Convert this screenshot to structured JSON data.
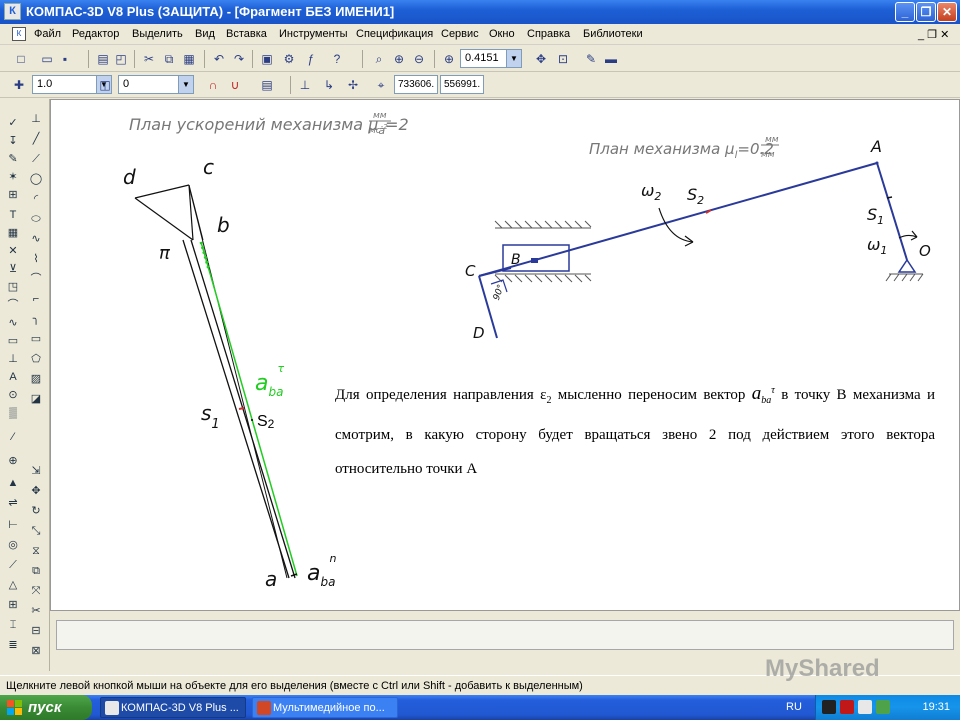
{
  "window": {
    "title": "КОМПАС-3D V8 Plus (ЗАЩИТА) - [Фрагмент БЕЗ ИМЕНИ1]",
    "app_icon": "К",
    "minimize_icon": "_",
    "maximize_icon": "❐",
    "close_icon": "✕"
  },
  "menu": {
    "items": [
      "Файл",
      "Редактор",
      "Выделить",
      "Вид",
      "Вставка",
      "Инструменты",
      "Спецификация",
      "Сервис",
      "Окно",
      "Справка",
      "Библиотеки"
    ],
    "doc_controls": "_ ❐ ✕"
  },
  "toolbar": {
    "zoom_value": "0.4151",
    "style_value": "1.0",
    "layer_value": "0",
    "coord_x": "733606.",
    "coord_y": "556991."
  },
  "drawing": {
    "accel_plan_label": "План ускорений механизма μ",
    "accel_plan_sub": "a",
    "accel_plan_eq": "=2",
    "accel_plan_unit_top": "мм",
    "accel_plan_unit_bottom": "мс",
    "accel_plan_unit_exp": "-2",
    "mech_plan_label": "План механизма μ",
    "mech_plan_sub": "l",
    "mech_plan_eq": "=0.2",
    "mech_plan_unit_top": "мм",
    "mech_plan_unit_bottom": "мм",
    "pt_d": "d",
    "pt_c": "c",
    "pt_b": "b",
    "pt_pi": "π",
    "pt_s1": "s",
    "pt_s1_sub": "1",
    "pt_s2": "S",
    "pt_s2_sub": "2",
    "pt_a": "a",
    "a_ba_tau": "a",
    "a_ba_tau_sub": "ba",
    "a_ba_tau_sup": "τ",
    "a_ba_n": "a",
    "a_ba_n_sub": "ba",
    "a_ba_n_sup": "n",
    "mech_A": "A",
    "mech_B": "B",
    "mech_C": "C",
    "mech_D": "D",
    "mech_O": "O",
    "mech_S1": "S",
    "mech_S1_sub": "1",
    "mech_S2": "S",
    "mech_S2_sub": "2",
    "mech_w1": "ω",
    "mech_w1_sub": "1",
    "mech_w2": "ω",
    "mech_w2_sub": "2",
    "mech_angle": "90°"
  },
  "note": {
    "part1": "Для определения направления ε",
    "eps_sub": "2",
    "part2": " мысленно переносим вектор ",
    "vec_a": "a",
    "vec_sub": "ba",
    "vec_sup": "τ",
    "part3": " в точку В механизма и смотрим, в какую сторону будет вращаться звено 2 под действием этого вектора относительно точки А"
  },
  "status": {
    "text": "Щелкните левой кнопкой мыши на объекте для его выделения (вместе с Ctrl или Shift - добавить к выделенным)"
  },
  "taskbar": {
    "start": "пуск",
    "task1": "КОМПАС-3D V8 Plus ...",
    "task2": "Мультимедийное по...",
    "lang": "RU",
    "clock": "19:31"
  },
  "watermark": "MyShared"
}
